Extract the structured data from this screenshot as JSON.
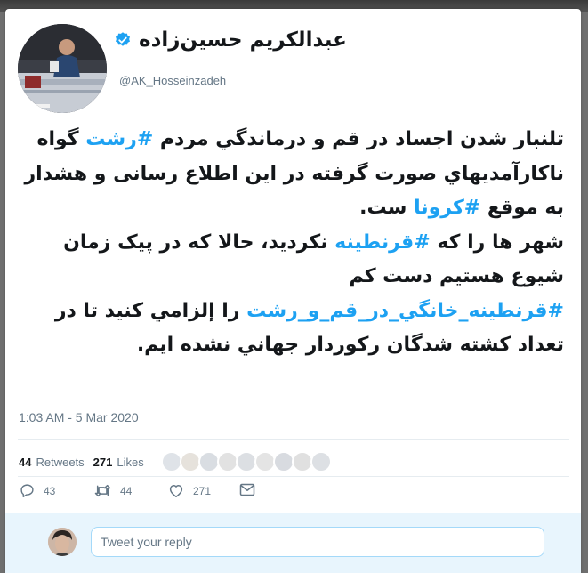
{
  "tweet": {
    "author": {
      "display_name": "عبدالکریم حسین‌زاده",
      "handle": "@AK_Hosseinzadeh",
      "verified": true,
      "avatar_icon": "profile-photo-speaker-at-podium"
    },
    "text_lines": [
      {
        "pre": "تلنبار شدن اجساد در قم و درماندگي مردم ",
        "tag": "#رشت",
        "post": " گواه"
      },
      {
        "pre": "ناکارآمديهاي صورت گرفته در اين اطلاع رسانی و هشدار",
        "tag": "",
        "post": ""
      },
      {
        "pre": "به موقع ",
        "tag": "#کرونا",
        "post": " ست."
      },
      {
        "pre": "شهر ها را که ",
        "tag": "#قرنطينه",
        "post": " نکرديد، حالا که در پيک زمان"
      },
      {
        "pre": "شيوع هستيم دست کم",
        "tag": "",
        "post": ""
      },
      {
        "pre": "",
        "tag": "#قرنطينه_خانگي_در_قم_و_رشت",
        "post": " را إلزامي کنيد تا در"
      },
      {
        "pre": "تعداد کشته شدگان رکوردار جهاني نشده ايم.",
        "tag": "",
        "post": ""
      }
    ],
    "timestamp": "1:03 AM - 5 Mar 2020",
    "stats": {
      "retweets_count": "44",
      "retweets_label": "Retweets",
      "likes_count": "271",
      "likes_label": "Likes"
    },
    "actions": {
      "reply_count": "43",
      "retweet_count": "44",
      "like_count": "271"
    }
  },
  "reply_box": {
    "placeholder": "Tweet your reply"
  },
  "colors": {
    "hashtag": "#1da1f2",
    "text": "#14171a",
    "secondary": "#657786",
    "reply_bg": "#e8f5fd"
  }
}
